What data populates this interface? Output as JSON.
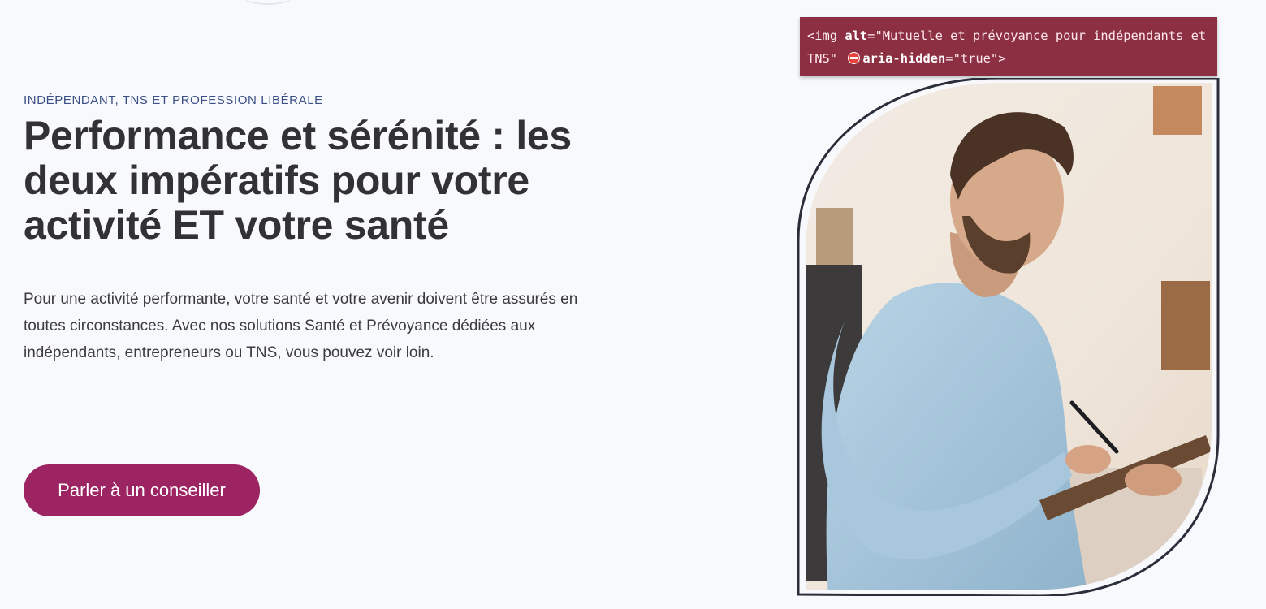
{
  "hero": {
    "eyebrow": "INDÉPENDANT, TNS ET PROFESSION LIBÉRALE",
    "title": "Performance et sérénité : les deux impératifs pour votre activité ET votre santé",
    "description": "Pour une activité performante, votre santé et votre avenir doivent être assurés en toutes circonstances. Avec nos solutions Santé et Prévoyance dédiées aux indépendants, entrepreneurs ou TNS, vous pouvez voir loin.",
    "cta_label": "Parler à un conseiller",
    "accent_color": "#9c2462",
    "eyebrow_color": "#3a4f85"
  },
  "inspector_tooltip": {
    "open": "<img ",
    "attr_alt": "alt",
    "eq": "=",
    "alt_value": "\"Mutuelle et prévoyance pour indépendants et TNS\"",
    "warning_icon": "no-entry-icon",
    "attr_aria": "aria-hidden",
    "aria_value": "\"true\"",
    "close": ">",
    "background_color": "#8d2f43"
  },
  "hero_image": {
    "subject": "man-writing-on-clipboard",
    "border_color": "#2a2d3a"
  }
}
